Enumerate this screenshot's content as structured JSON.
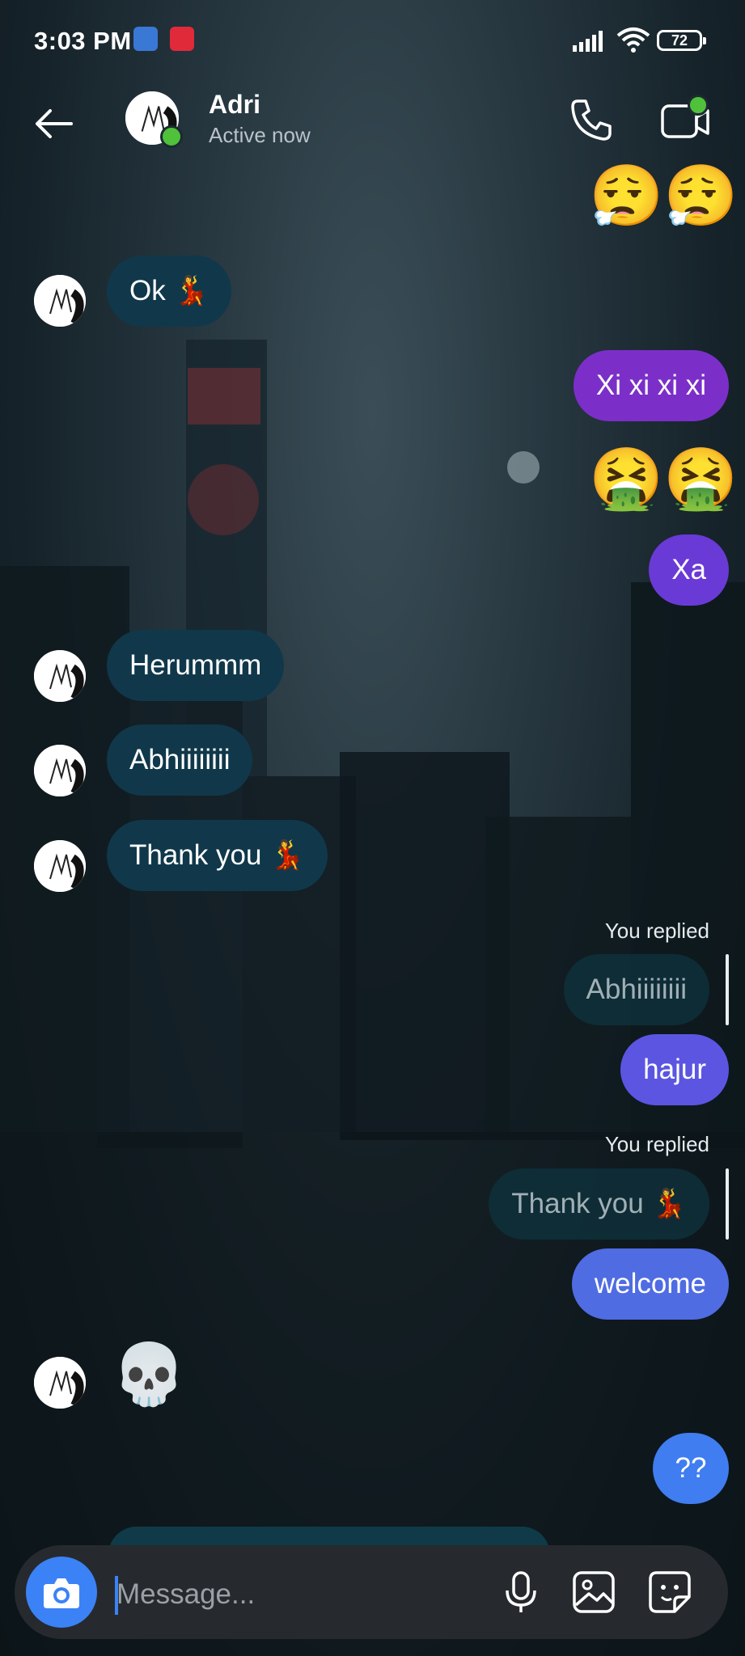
{
  "status_bar": {
    "time": "3:03 PM",
    "battery": "72"
  },
  "header": {
    "contact_name": "Adri",
    "contact_status": "Active now"
  },
  "messages": {
    "m1_emoji": "😮‍💨😮‍💨",
    "m2_text": "Ok 💃",
    "m3_text": "Xi xi xi xi",
    "m4_emoji": "🤮🤮",
    "m5_text": "Xa",
    "m6_text": "Herummm",
    "m7_text": "Abhiiiiiiii",
    "m8_text": "Thank you 💃",
    "reply1_label": "You replied",
    "reply1_quote": "Abhiiiiiiii",
    "m9_text": "hajur",
    "reply2_label": "You replied",
    "reply2_quote": "Thank you 💃",
    "m10_text": "welcome",
    "m11_emoji": "💀",
    "m12_text": "??"
  },
  "composer": {
    "placeholder": "Message..."
  },
  "colors": {
    "incoming_bubble": "#10384a",
    "outgoing_purple": "#7b2fc8",
    "outgoing_blue": "#4f6ce3",
    "online_green": "#4fc13a",
    "camera_blue": "#3b82f6"
  },
  "icons": {
    "back": "arrow-left-icon",
    "call": "phone-icon",
    "video": "video-camera-icon",
    "camera": "camera-icon",
    "mic": "microphone-icon",
    "gallery": "image-icon",
    "sticker": "sticker-icon"
  }
}
